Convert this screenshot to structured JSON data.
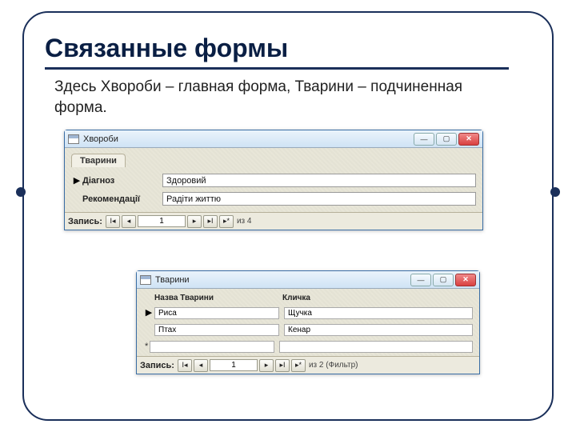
{
  "slide": {
    "title": "Связанные формы",
    "desc": "Здесь Хвороби – главная форма, Тварини – подчиненная форма."
  },
  "win1": {
    "title": "Хвороби",
    "tab": "Тварини",
    "rows": [
      {
        "label": "Діагноз",
        "value": "Здоровий"
      },
      {
        "label": "Рекомендації",
        "value": "Радіти життю"
      }
    ],
    "nav": {
      "label": "Запись:",
      "pos": "1",
      "total": "из  4"
    }
  },
  "win2": {
    "title": "Тварини",
    "headers": {
      "h1": "Назва Тварини",
      "h2": "Кличка"
    },
    "rows": [
      {
        "c1": "Риса",
        "c2": "Щучка"
      },
      {
        "c1": "Птах",
        "c2": "Кенар"
      }
    ],
    "nav": {
      "label": "Запись:",
      "pos": "1",
      "total": "из 2 (Фильтр)"
    }
  },
  "winbtns": {
    "min": "—",
    "max": "▢",
    "close": "✕"
  }
}
